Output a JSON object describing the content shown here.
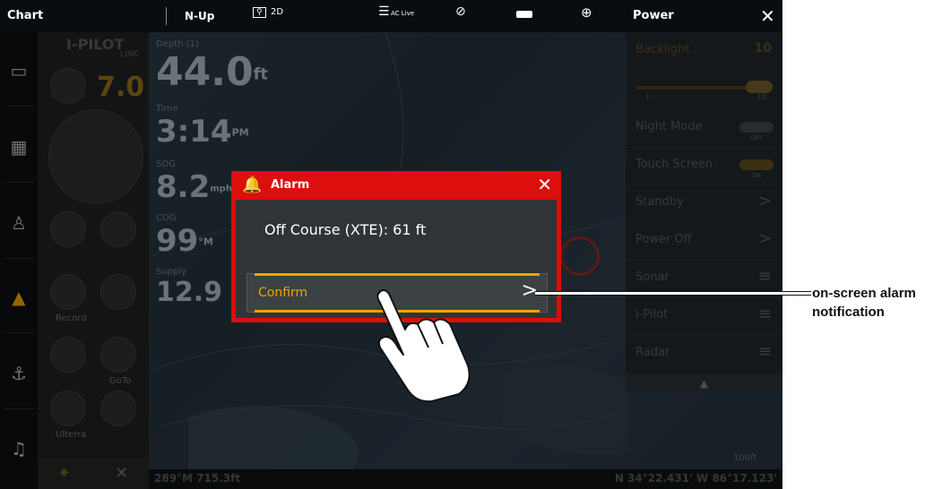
{
  "topbar": {
    "title": "Chart",
    "orientation": "N-Up",
    "view_mode": "2D",
    "ac_live": "AC Live",
    "panel_title": "Power"
  },
  "pilot": {
    "logo": "I-PILOT",
    "logo_sub": "LINK",
    "speed": "7.0",
    "record": "Record",
    "goto": "GoTo",
    "ulterra": "Ulterra"
  },
  "data_overlay": {
    "depth_label": "Depth (1)",
    "depth_value": "44.0",
    "depth_unit": "ft",
    "time_label": "Time",
    "time_value": "3:14",
    "time_unit": "PM",
    "sog_label": "SOG",
    "sog_value": "8.2",
    "sog_unit": "mph",
    "cog_label": "COG",
    "cog_value": "99",
    "cog_unit": "°M",
    "supply_label": "Supply",
    "supply_value": "12.9"
  },
  "power_panel": {
    "backlight_label": "Backlight",
    "backlight_value": "10",
    "backlight_min": "1",
    "backlight_max": "10",
    "backlight_level": 1.0,
    "rows": [
      {
        "label": "Night Mode",
        "state": "OFF"
      },
      {
        "label": "Touch Screen",
        "state": "ON"
      },
      {
        "label": "Standby",
        "icon": "chevron-right-icon"
      },
      {
        "label": "Power Off",
        "icon": "chevron-right-icon"
      },
      {
        "label": "Sonar",
        "icon": "menu-icon"
      },
      {
        "label": "i-Pilot",
        "icon": "menu-icon"
      },
      {
        "label": "Radar",
        "icon": "menu-icon"
      }
    ]
  },
  "status_bar": {
    "heading": "289°M 715.3ft",
    "position": "N 34°22.431' W 86°17.123'",
    "scale": "100ft"
  },
  "alarm": {
    "title": "Alarm",
    "message": "Off Course (XTE): 61 ft",
    "confirm_label": "Confirm",
    "accent_color": "#dc0e0e",
    "confirm_color": "#f0a400"
  },
  "callout": {
    "line1": "on-screen alarm",
    "line2": "notification"
  }
}
